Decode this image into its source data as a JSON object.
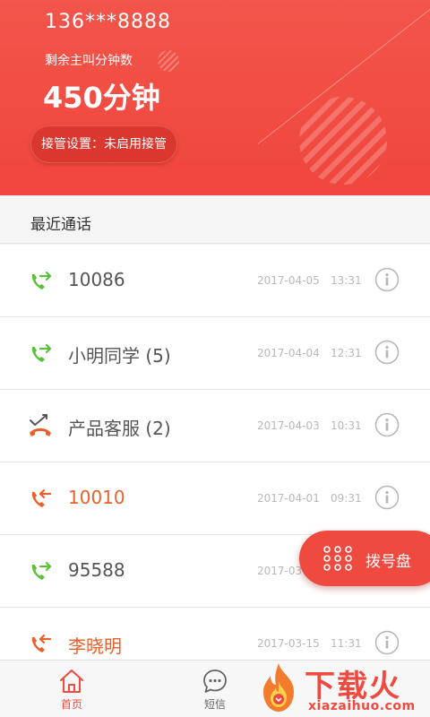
{
  "account": {
    "phone": "136***8888",
    "minutes_label": "剩余主叫分钟数",
    "minutes_value": "450分钟",
    "takeover_button": "接管设置：未启用接管"
  },
  "recent": {
    "title": "最近通话",
    "calls": [
      {
        "name": "10086",
        "date": "2017-04-05",
        "time": "13:31",
        "type": "outgoing",
        "color": "#5cbf3a"
      },
      {
        "name": "小明同学 (5)",
        "date": "2017-04-04",
        "time": "12:31",
        "type": "outgoing",
        "color": "#5cbf3a"
      },
      {
        "name": "产品客服 (2)",
        "date": "2017-04-03",
        "time": "10:31",
        "type": "missed",
        "color": "#555555"
      },
      {
        "name": "10010",
        "date": "2017-04-01",
        "time": "09:31",
        "type": "incoming",
        "color": "#e8612c"
      },
      {
        "name": "95588",
        "date": "2017-03",
        "time": "",
        "type": "outgoing",
        "color": "#5cbf3a"
      },
      {
        "name": "李晓明",
        "date": "2017-03-15",
        "time": "11:31",
        "type": "incoming",
        "color": "#e8612c"
      }
    ]
  },
  "dialpad": {
    "label": "拨号盘"
  },
  "nav": {
    "home": "首页",
    "sms": "短信"
  },
  "watermark": {
    "brand": "下载火",
    "url": "xiazaihuo.com"
  },
  "colors": {
    "accent": "#ef4a40",
    "outgoing": "#5cbf3a",
    "incoming": "#e8612c"
  }
}
